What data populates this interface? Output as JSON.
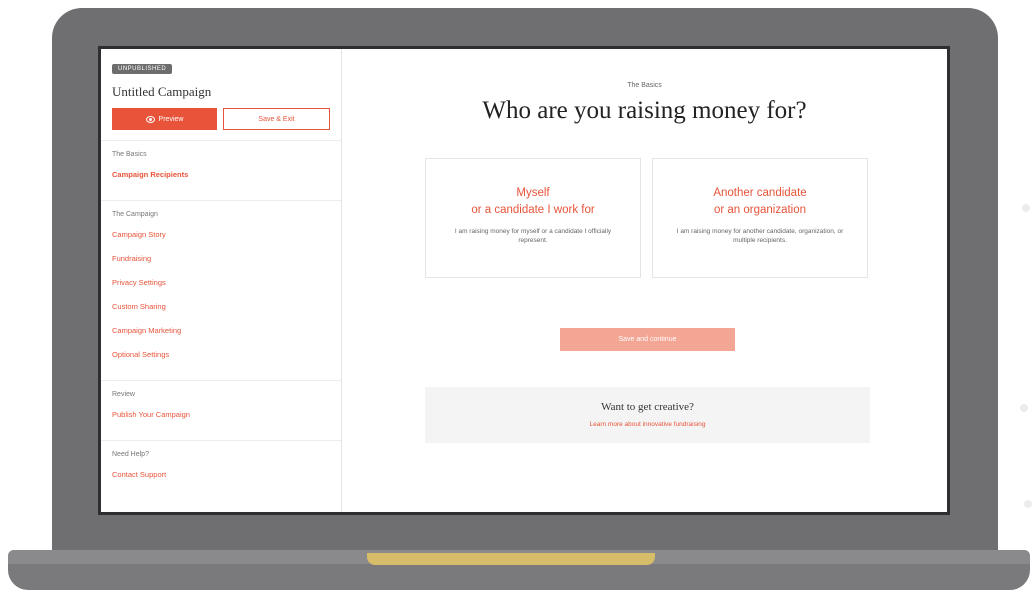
{
  "sidebar": {
    "status_badge": "UNPUBLISHED",
    "campaign_title": "Untitled Campaign",
    "preview_label": "Preview",
    "save_exit_label": "Save & Exit",
    "sections": [
      {
        "label": "The Basics",
        "items": [
          "Campaign Recipients"
        ]
      },
      {
        "label": "The Campaign",
        "items": [
          "Campaign Story",
          "Fundraising",
          "Privacy Settings",
          "Custom Sharing",
          "Campaign Marketing",
          "Optional Settings"
        ]
      },
      {
        "label": "Review",
        "items": [
          "Publish Your Campaign"
        ]
      },
      {
        "label": "Need Help?",
        "items": [
          "Contact Support"
        ]
      }
    ],
    "active_item": "Campaign Recipients"
  },
  "main": {
    "eyebrow": "The Basics",
    "title": "Who are you raising money for?",
    "options": [
      {
        "title_line1": "Myself",
        "title_line2": "or a candidate I work for",
        "description": "I am raising money for myself or a candidate I officially represent."
      },
      {
        "title_line1": "Another candidate",
        "title_line2": "or an organization",
        "description": "I am raising money for another candidate, organization, or multiple recipients."
      }
    ],
    "continue_label": "Save and continue",
    "creative": {
      "title": "Want to get creative?",
      "link": "Learn more about innovative fundraising"
    }
  },
  "colors": {
    "accent": "#e8543a",
    "accent_disabled": "#f3a694",
    "frame": "#6f6f71",
    "hinge": "#d7bc6a"
  },
  "icons": {
    "preview": "eye-icon"
  }
}
